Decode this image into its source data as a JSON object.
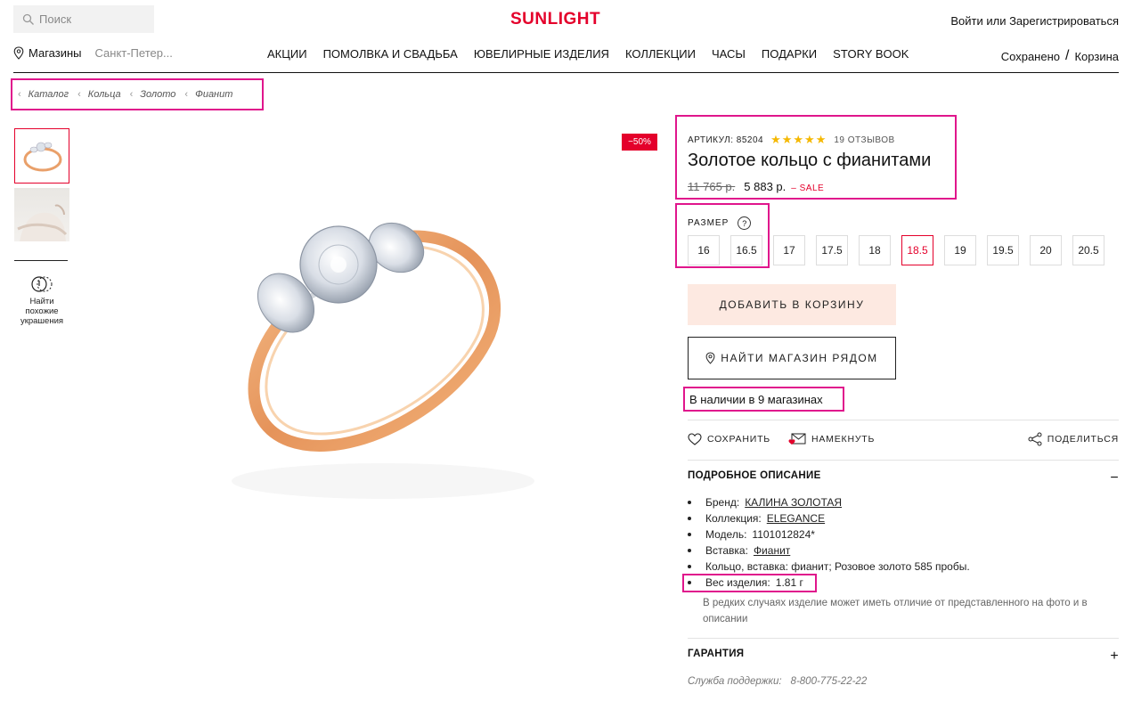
{
  "header": {
    "search_placeholder": "Поиск",
    "logo": "SUNLIGHT",
    "login": "Войти или Зарегистрироваться",
    "stores_label": "Магазины",
    "city": "Санкт-Петер...",
    "menu": [
      "АКЦИИ",
      "ПОМОЛВКА И СВАДЬБА",
      "ЮВЕЛИРНЫЕ ИЗДЕЛИЯ",
      "КОЛЛЕКЦИИ",
      "ЧАСЫ",
      "ПОДАРКИ",
      "STORY BOOK"
    ],
    "saved": "Сохранено",
    "separator": "/",
    "cart": "Корзина"
  },
  "breadcrumb": [
    "Каталог",
    "Кольца",
    "Золото",
    "Фианит"
  ],
  "gallery": {
    "similar_label_1": "Найти",
    "similar_label_2": "похожие",
    "similar_label_3": "украшения",
    "discount": "−50%"
  },
  "product": {
    "sku_label": "АРТИКУЛ: 85204",
    "rating": 5,
    "stars": "★★★★★",
    "reviews": "19 ОТЗЫВОВ",
    "title": "Золотое кольцо с фианитами",
    "old_price": "11 765 р.",
    "price": "5 883 р.",
    "sale_label": "– SALE",
    "size_label": "РАЗМЕР",
    "size_help": "?",
    "sizes": [
      "16",
      "16.5",
      "17",
      "17.5",
      "18",
      "18.5",
      "19",
      "19.5",
      "20",
      "20.5"
    ],
    "selected_size": "18.5",
    "add_to_cart": "ДОБАВИТЬ В КОРЗИНУ",
    "find_store": "НАЙТИ МАГАЗИН РЯДОМ",
    "availability": "В наличии в 9 магазинах",
    "actions": {
      "save": "СОХРАНИТЬ",
      "hint": "НАМЕКНУТЬ",
      "share": "ПОДЕЛИТЬСЯ"
    }
  },
  "description": {
    "title": "ПОДРОБНОЕ ОПИСАНИЕ",
    "toggle": "−",
    "brand_label": "Бренд:",
    "brand": "КАЛИНА ЗОЛОТАЯ",
    "collection_label": "Коллекция:",
    "collection": "ELEGANCE",
    "model_label": "Модель:",
    "model": "1101012824*",
    "insert_label": "Вставка:",
    "insert": "Фианит",
    "composition": "Кольцо, вставка: фианит; Розовое золото 585 пробы.",
    "weight_label": "Вес изделия:",
    "weight": "1.81 г",
    "note": "В редких случаях изделие может иметь отличие от представленного на фото и в описании"
  },
  "guarantee": {
    "title": "ГАРАНТИЯ",
    "toggle": "+"
  },
  "support": {
    "label": "Служба поддержки:",
    "phone": "8-800-775-22-22"
  },
  "colors": {
    "brand_red": "#e4002b",
    "highlight": "#e0168c",
    "cart_button_bg": "#fde9e1",
    "star": "#f5b800"
  }
}
